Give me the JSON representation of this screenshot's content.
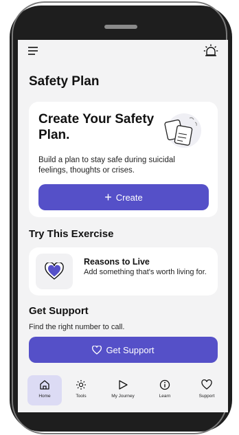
{
  "page": {
    "title": "Safety Plan"
  },
  "create_card": {
    "title": "Create Your Safety Plan.",
    "description": "Build a plan to stay safe during suicidal feelings, thoughts or crises.",
    "button_label": "Create"
  },
  "exercise": {
    "section_title": "Try This Exercise",
    "title": "Reasons to Live",
    "description": "Add something that's worth living for."
  },
  "support": {
    "section_title": "Get Support",
    "subtitle": "Find the right number to call.",
    "button_label": "Get Support"
  },
  "tabs": [
    {
      "label": "Home",
      "icon": "home-icon",
      "active": true
    },
    {
      "label": "Tools",
      "icon": "sun-icon",
      "active": false
    },
    {
      "label": "My Journey",
      "icon": "play-icon",
      "active": false
    },
    {
      "label": "Learn",
      "icon": "info-icon",
      "active": false
    },
    {
      "label": "Support",
      "icon": "heart-icon",
      "active": false
    }
  ],
  "colors": {
    "accent": "#5550c8",
    "background": "#f3f3f4",
    "card": "#ffffff",
    "active_tab": "#dcdbf4"
  }
}
